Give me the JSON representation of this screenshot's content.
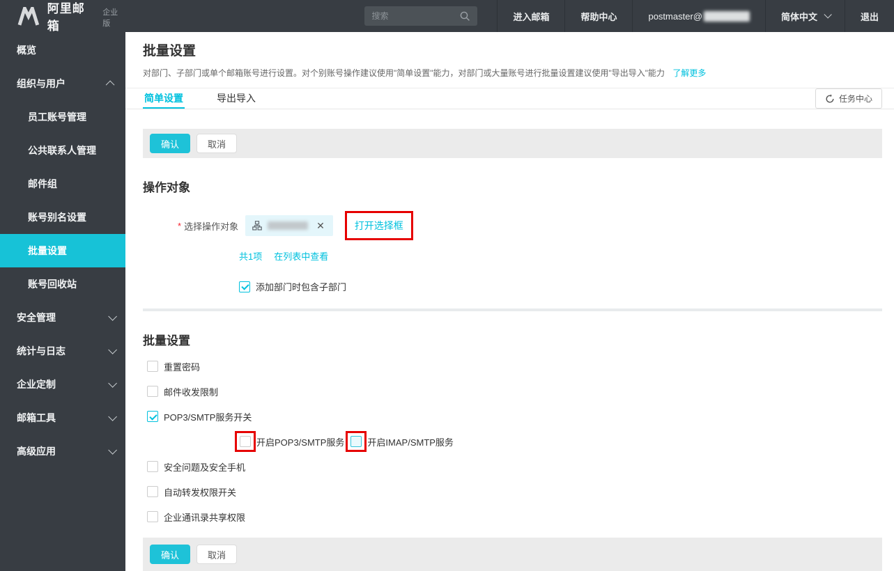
{
  "colors": {
    "accent": "#00c1de",
    "highlight_red": "#e60000",
    "header_bg": "#383d43",
    "sidebar_active_bg": "#17c2d7",
    "action_bar_bg": "#ebebeb"
  },
  "header": {
    "logo_text": "阿里邮箱",
    "logo_badge": "企业版",
    "search_placeholder": "搜索",
    "nav": {
      "enter_mailbox": "进入邮箱",
      "help_center": "帮助中心",
      "account_prefix": "postmaster@",
      "language": "简体中文",
      "logout": "退出"
    }
  },
  "sidebar": {
    "items": [
      {
        "label": "概览",
        "level": "top"
      },
      {
        "label": "组织与用户",
        "level": "top",
        "expanded": true
      },
      {
        "label": "员工账号管理",
        "level": "sub"
      },
      {
        "label": "公共联系人管理",
        "level": "sub"
      },
      {
        "label": "邮件组",
        "level": "sub"
      },
      {
        "label": "账号别名设置",
        "level": "sub"
      },
      {
        "label": "批量设置",
        "level": "sub",
        "active": true
      },
      {
        "label": "账号回收站",
        "level": "sub"
      },
      {
        "label": "安全管理",
        "level": "top",
        "expanded": false
      },
      {
        "label": "统计与日志",
        "level": "top",
        "expanded": false
      },
      {
        "label": "企业定制",
        "level": "top",
        "expanded": false
      },
      {
        "label": "邮箱工具",
        "level": "top",
        "expanded": false
      },
      {
        "label": "高级应用",
        "level": "top",
        "expanded": false
      }
    ]
  },
  "page": {
    "title": "批量设置",
    "description": "对部门、子部门或单个邮箱账号进行设置。对个别账号操作建议使用\"简单设置\"能力，对部门或大量账号进行批量设置建议使用\"导出导入\"能力",
    "learn_more": "了解更多",
    "tabs": [
      {
        "label": "简单设置",
        "active": true
      },
      {
        "label": "导出导入",
        "active": false
      }
    ],
    "task_center": "任务中心"
  },
  "actions": {
    "confirm": "确认",
    "cancel": "取消"
  },
  "target_section": {
    "heading": "操作对象",
    "required_mark": "*",
    "label": "选择操作对象",
    "chip": {
      "icon": "org-tree-icon",
      "name_blurred": true,
      "close_glyph": "✕"
    },
    "open_selector": "打开选择框",
    "count_text": "共1项",
    "view_in_list": "在列表中查看",
    "include_sub_departments": {
      "label": "添加部门时包含子部门",
      "checked": true
    }
  },
  "batch_section": {
    "heading": "批量设置",
    "options": [
      {
        "label": "重置密码",
        "checked": false
      },
      {
        "label": "邮件收发限制",
        "checked": false
      },
      {
        "label": "POP3/SMTP服务开关",
        "checked": true
      },
      {
        "label": "安全问题及安全手机",
        "checked": false
      },
      {
        "label": "自动转发权限开关",
        "checked": false
      },
      {
        "label": "企业通讯录共享权限",
        "checked": false
      }
    ],
    "sub_options": [
      {
        "label": "开启POP3/SMTP服务",
        "checked": false,
        "highlighted": true
      },
      {
        "label": "开启IMAP/SMTP服务",
        "checked": false,
        "highlighted": true,
        "focused": true
      }
    ]
  }
}
